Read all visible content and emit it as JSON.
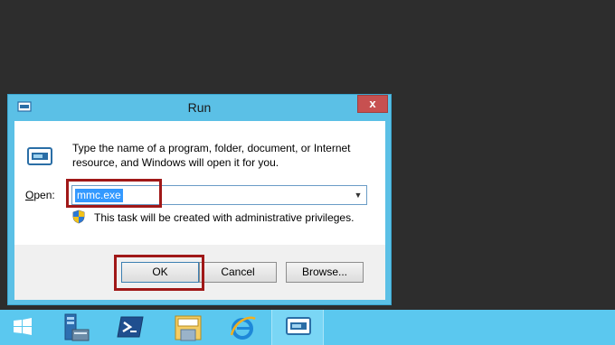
{
  "dialog": {
    "title": "Run",
    "close_label": "x",
    "description": "Type the name of a program, folder, document, or Internet resource, and Windows will open it for you.",
    "open_label": "Open:",
    "open_value": "mmc.exe",
    "privilege_text": "This task will be created with administrative privileges.",
    "buttons": {
      "ok": "OK",
      "cancel": "Cancel",
      "browse": "Browse..."
    }
  },
  "taskbar": {
    "items": [
      {
        "icon": "windows-start-icon"
      },
      {
        "icon": "server-manager-icon"
      },
      {
        "icon": "powershell-icon"
      },
      {
        "icon": "file-explorer-icon"
      },
      {
        "icon": "internet-explorer-icon"
      },
      {
        "icon": "run-dialog-icon",
        "active": true
      }
    ]
  },
  "colors": {
    "desktop": "#2d2d2d",
    "chrome": "#5bc0e6",
    "taskbar": "#5bc8ef",
    "highlight": "#a01818",
    "selection": "#3399ff",
    "close": "#c75050"
  }
}
